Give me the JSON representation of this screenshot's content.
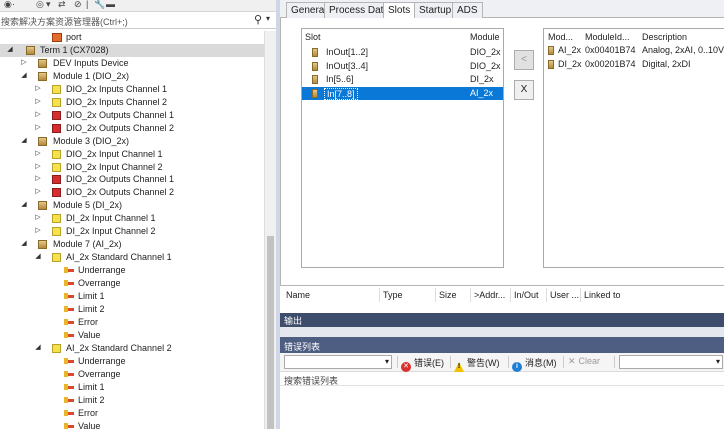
{
  "explorer": {
    "search_placeholder": "搜索解决方案资源管理器(Ctrl+;)",
    "toolbar_glyphs": [
      "◉",
      "·",
      "◎",
      "▾",
      "⇄",
      "⊘",
      "|",
      "🔧",
      "▬"
    ],
    "tree": [
      {
        "label": "port",
        "icon": "port",
        "level": 3,
        "expander": ""
      },
      {
        "label": "Term 1 (CX7028)",
        "icon": "term",
        "level": 1,
        "expander": "◢"
      },
      {
        "label": "DEV Inputs Device",
        "icon": "term",
        "level": 2,
        "expander": "▷"
      },
      {
        "label": "Module 1 (DIO_2x)",
        "icon": "term",
        "level": 2,
        "expander": "◢"
      },
      {
        "label": "DIO_2x Inputs Channel 1",
        "icon": "yellow",
        "level": 3,
        "expander": "▷"
      },
      {
        "label": "DIO_2x Inputs Channel 2",
        "icon": "yellow",
        "level": 3,
        "expander": "▷"
      },
      {
        "label": "DIO_2x Outputs Channel 1",
        "icon": "red",
        "level": 3,
        "expander": "▷"
      },
      {
        "label": "DIO_2x Outputs Channel 2",
        "icon": "red",
        "level": 3,
        "expander": "▷"
      },
      {
        "label": "Module 3 (DIO_2x)",
        "icon": "term",
        "level": 2,
        "expander": "◢"
      },
      {
        "label": "DIO_2x Input Channel 1",
        "icon": "yellow",
        "level": 3,
        "expander": "▷"
      },
      {
        "label": "DIO_2x Input Channel 2",
        "icon": "yellow",
        "level": 3,
        "expander": "▷"
      },
      {
        "label": "DIO_2x Outputs Channel 1",
        "icon": "red",
        "level": 3,
        "expander": "▷"
      },
      {
        "label": "DIO_2x Outputs Channel 2",
        "icon": "red",
        "level": 3,
        "expander": "▷"
      },
      {
        "label": "Module 5 (DI_2x)",
        "icon": "term",
        "level": 2,
        "expander": "◢"
      },
      {
        "label": "DI_2x Input Channel 1",
        "icon": "yellow",
        "level": 3,
        "expander": "▷"
      },
      {
        "label": "DI_2x Input Channel 2",
        "icon": "yellow",
        "level": 3,
        "expander": "▷"
      },
      {
        "label": "Module 7 (AI_2x)",
        "icon": "term",
        "level": 2,
        "expander": "◢"
      },
      {
        "label": "AI_2x Standard Channel 1",
        "icon": "yellow",
        "level": 3,
        "expander": "◢"
      },
      {
        "label": "Underrange",
        "icon": "var",
        "level": 4,
        "expander": ""
      },
      {
        "label": "Overrange",
        "icon": "var",
        "level": 4,
        "expander": ""
      },
      {
        "label": "Limit 1",
        "icon": "var",
        "level": 4,
        "expander": ""
      },
      {
        "label": "Limit 2",
        "icon": "var",
        "level": 4,
        "expander": ""
      },
      {
        "label": "Error",
        "icon": "var",
        "level": 4,
        "expander": ""
      },
      {
        "label": "Value",
        "icon": "var",
        "level": 4,
        "expander": ""
      },
      {
        "label": "AI_2x Standard Channel 2",
        "icon": "yellow",
        "level": 3,
        "expander": "◢"
      },
      {
        "label": "Underrange",
        "icon": "var",
        "level": 4,
        "expander": ""
      },
      {
        "label": "Overrange",
        "icon": "var",
        "level": 4,
        "expander": ""
      },
      {
        "label": "Limit 1",
        "icon": "var",
        "level": 4,
        "expander": ""
      },
      {
        "label": "Limit 2",
        "icon": "var",
        "level": 4,
        "expander": ""
      },
      {
        "label": "Error",
        "icon": "var",
        "level": 4,
        "expander": ""
      },
      {
        "label": "Value",
        "icon": "var",
        "level": 4,
        "expander": ""
      }
    ]
  },
  "tabs": [
    "General",
    "Process Data",
    "Slots",
    "Startup",
    "ADS"
  ],
  "active_tab": "Slots",
  "slots": {
    "header_slot": "Slot",
    "header_module": "Module",
    "rows": [
      {
        "slot": "InOut[1..2]",
        "module": "DIO_2x",
        "selected": false
      },
      {
        "slot": "InOut[3..4]",
        "module": "DIO_2x",
        "selected": false
      },
      {
        "slot": "In[5..6]",
        "module": "DI_2x",
        "selected": false
      },
      {
        "slot": "In[7..8]",
        "module": "AI_2x",
        "selected": true
      }
    ],
    "add_button": "<",
    "remove_button": "X"
  },
  "modules": {
    "header_module": "Mod...",
    "header_id": "ModuleId...",
    "header_desc": "Description",
    "rows": [
      {
        "module": "AI_2x",
        "id": "0x00401B74",
        "desc": "Analog, 2xAI, 0..10V"
      },
      {
        "module": "DI_2x",
        "id": "0x00201B74",
        "desc": "Digital, 2xDI"
      }
    ]
  },
  "var_grid": {
    "columns": [
      "Name",
      "Type",
      "Size",
      ">Addr...",
      "In/Out",
      "User ...",
      "Linked to"
    ]
  },
  "output": {
    "title": "输出"
  },
  "error_list": {
    "title": "错误列表",
    "errors_label": "错误(E)",
    "warnings_label": "警告(W)",
    "messages_label": "消息(M)",
    "clear_label": "Clear",
    "search_placeholder": "搜索错误列表"
  },
  "colors": {
    "selection": "#0A78D7",
    "output_title": "#3D4D6B",
    "error_title": "#4E5E82"
  }
}
